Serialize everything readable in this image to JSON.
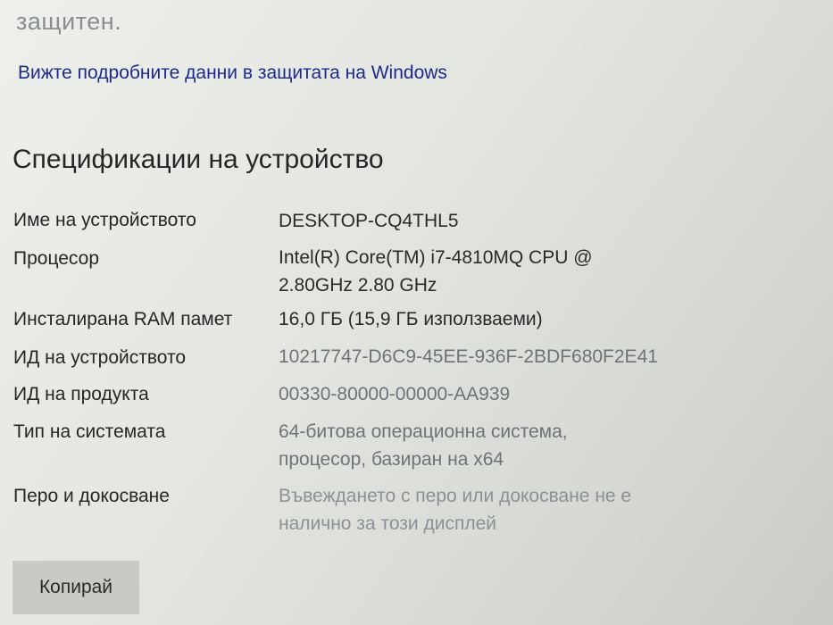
{
  "top_fragment": "защитен.",
  "security_link": "Вижте подробните данни в защитата на Windows",
  "section_title": "Спецификации на устройство",
  "specs": [
    {
      "label": "Име на устройството",
      "value": "DESKTOP-CQ4THL5"
    },
    {
      "label": "Процесор",
      "value": "Intel(R) Core(TM) i7-4810MQ CPU @ 2.80GHz   2.80 GHz"
    },
    {
      "label": "Инсталирана RAM памет",
      "value": "16,0 ГБ (15,9 ГБ използваеми)"
    },
    {
      "label": "ИД на устройството",
      "value": "10217747-D6C9-45EE-936F-2BDF680F2E41"
    },
    {
      "label": "ИД на продукта",
      "value": "00330-80000-00000-AA939"
    },
    {
      "label": "Тип на системата",
      "value": "64-битова операционна система, процесор, базиран на x64"
    },
    {
      "label": "Перо и докосване",
      "value": "Въвеждането с перо или докосване не е налично за този дисплей"
    }
  ],
  "copy_button": "Копирай"
}
